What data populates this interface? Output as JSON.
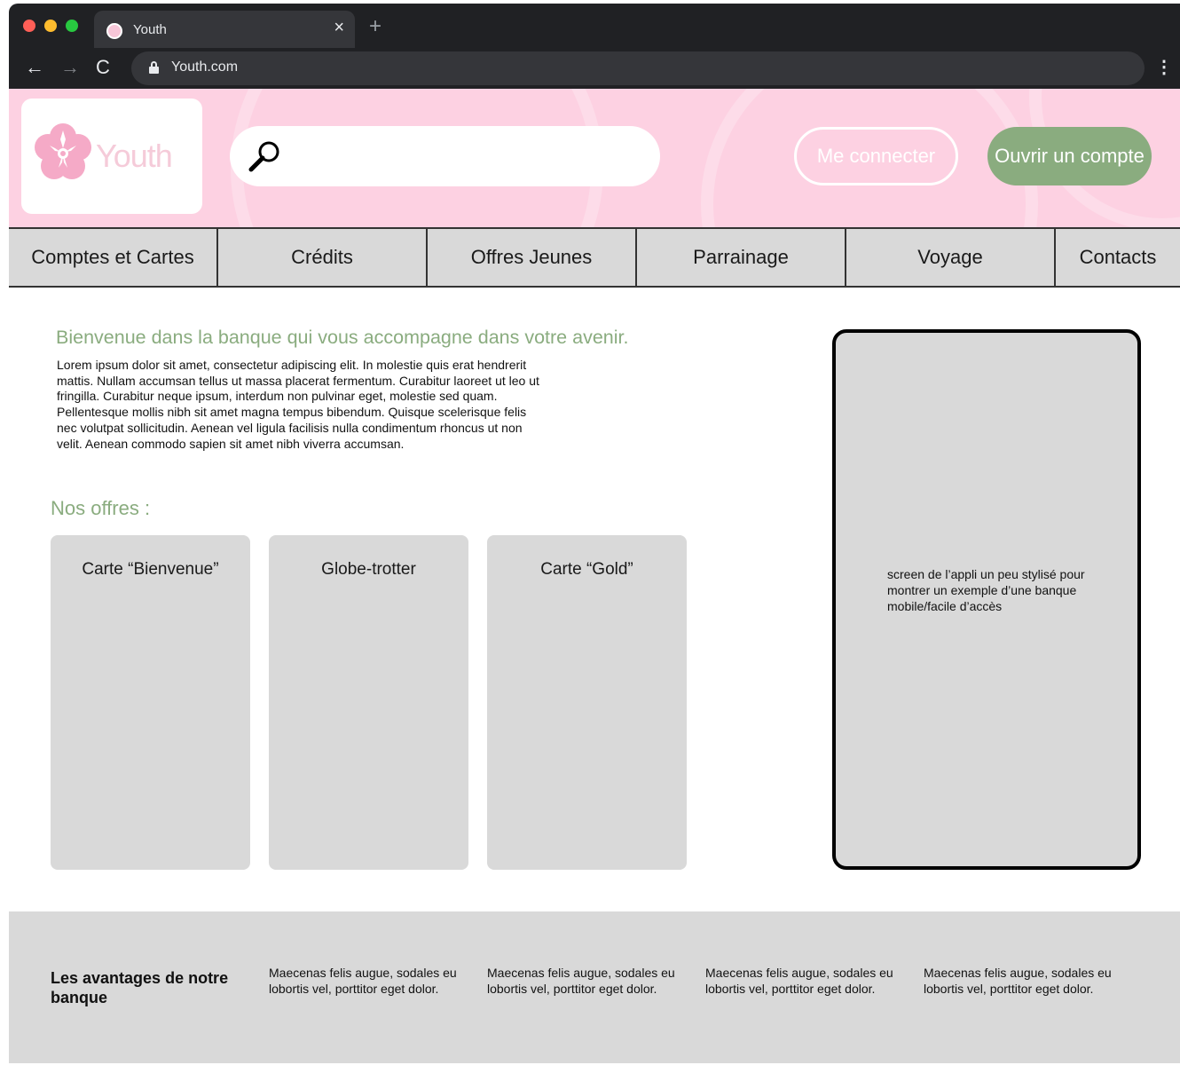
{
  "browser": {
    "tab_title": "Youth",
    "url": "Youth.com",
    "tab_close": "×",
    "new_tab": "+",
    "back": "←",
    "forward": "→",
    "reload": "C",
    "menu": "⋮"
  },
  "header": {
    "logo_text": "Youth",
    "search_placeholder": "",
    "login_label": "Me connecter",
    "open_account_label": "Ouvrir un compte"
  },
  "nav": {
    "items": [
      {
        "label": "Comptes et Cartes"
      },
      {
        "label": "Crédits"
      },
      {
        "label": "Offres Jeunes"
      },
      {
        "label": "Parrainage"
      },
      {
        "label": "Voyage"
      },
      {
        "label": "Contacts"
      }
    ]
  },
  "main": {
    "welcome_title": "Bienvenue dans la banque qui vous accompagne dans votre avenir.",
    "welcome_text": "Lorem ipsum dolor sit amet, consectetur adipiscing elit. In molestie quis erat hendrerit mattis. Nullam accumsan tellus ut massa placerat fermentum. Curabitur laoreet ut leo ut fringilla. Curabitur neque ipsum, interdum non pulvinar eget, molestie sed quam. Pellentesque mollis nibh sit amet magna tempus bibendum. Quisque scelerisque felis nec volutpat sollicitudin. Aenean vel ligula facilisis nulla condimentum rhoncus ut non velit. Aenean commodo sapien sit amet nibh viverra accumsan.",
    "offers_title": "Nos offres :",
    "offers": [
      {
        "label": "Carte “Bienvenue”"
      },
      {
        "label": "Globe-trotter"
      },
      {
        "label": "Carte “Gold”"
      }
    ],
    "phone_note": "screen de l’appli un peu stylisé pour montrer un exemple d’une banque mobile/facile d’accès"
  },
  "advantages": {
    "title": "Les avantages de notre banque",
    "items": [
      {
        "text": "Maecenas felis augue, sodales eu lobortis vel, porttitor eget dolor."
      },
      {
        "text": "Maecenas felis augue, sodales eu lobortis vel, porttitor eget dolor."
      },
      {
        "text": "Maecenas felis augue, sodales eu lobortis vel, porttitor eget dolor."
      },
      {
        "text": "Maecenas felis augue, sodales eu lobortis vel, porttitor eget dolor."
      }
    ]
  },
  "colors": {
    "header_bg": "#fdd1e2",
    "accent_green": "#8aac7f",
    "panel_gray": "#d9d9d9",
    "chrome_dark": "#202124"
  }
}
